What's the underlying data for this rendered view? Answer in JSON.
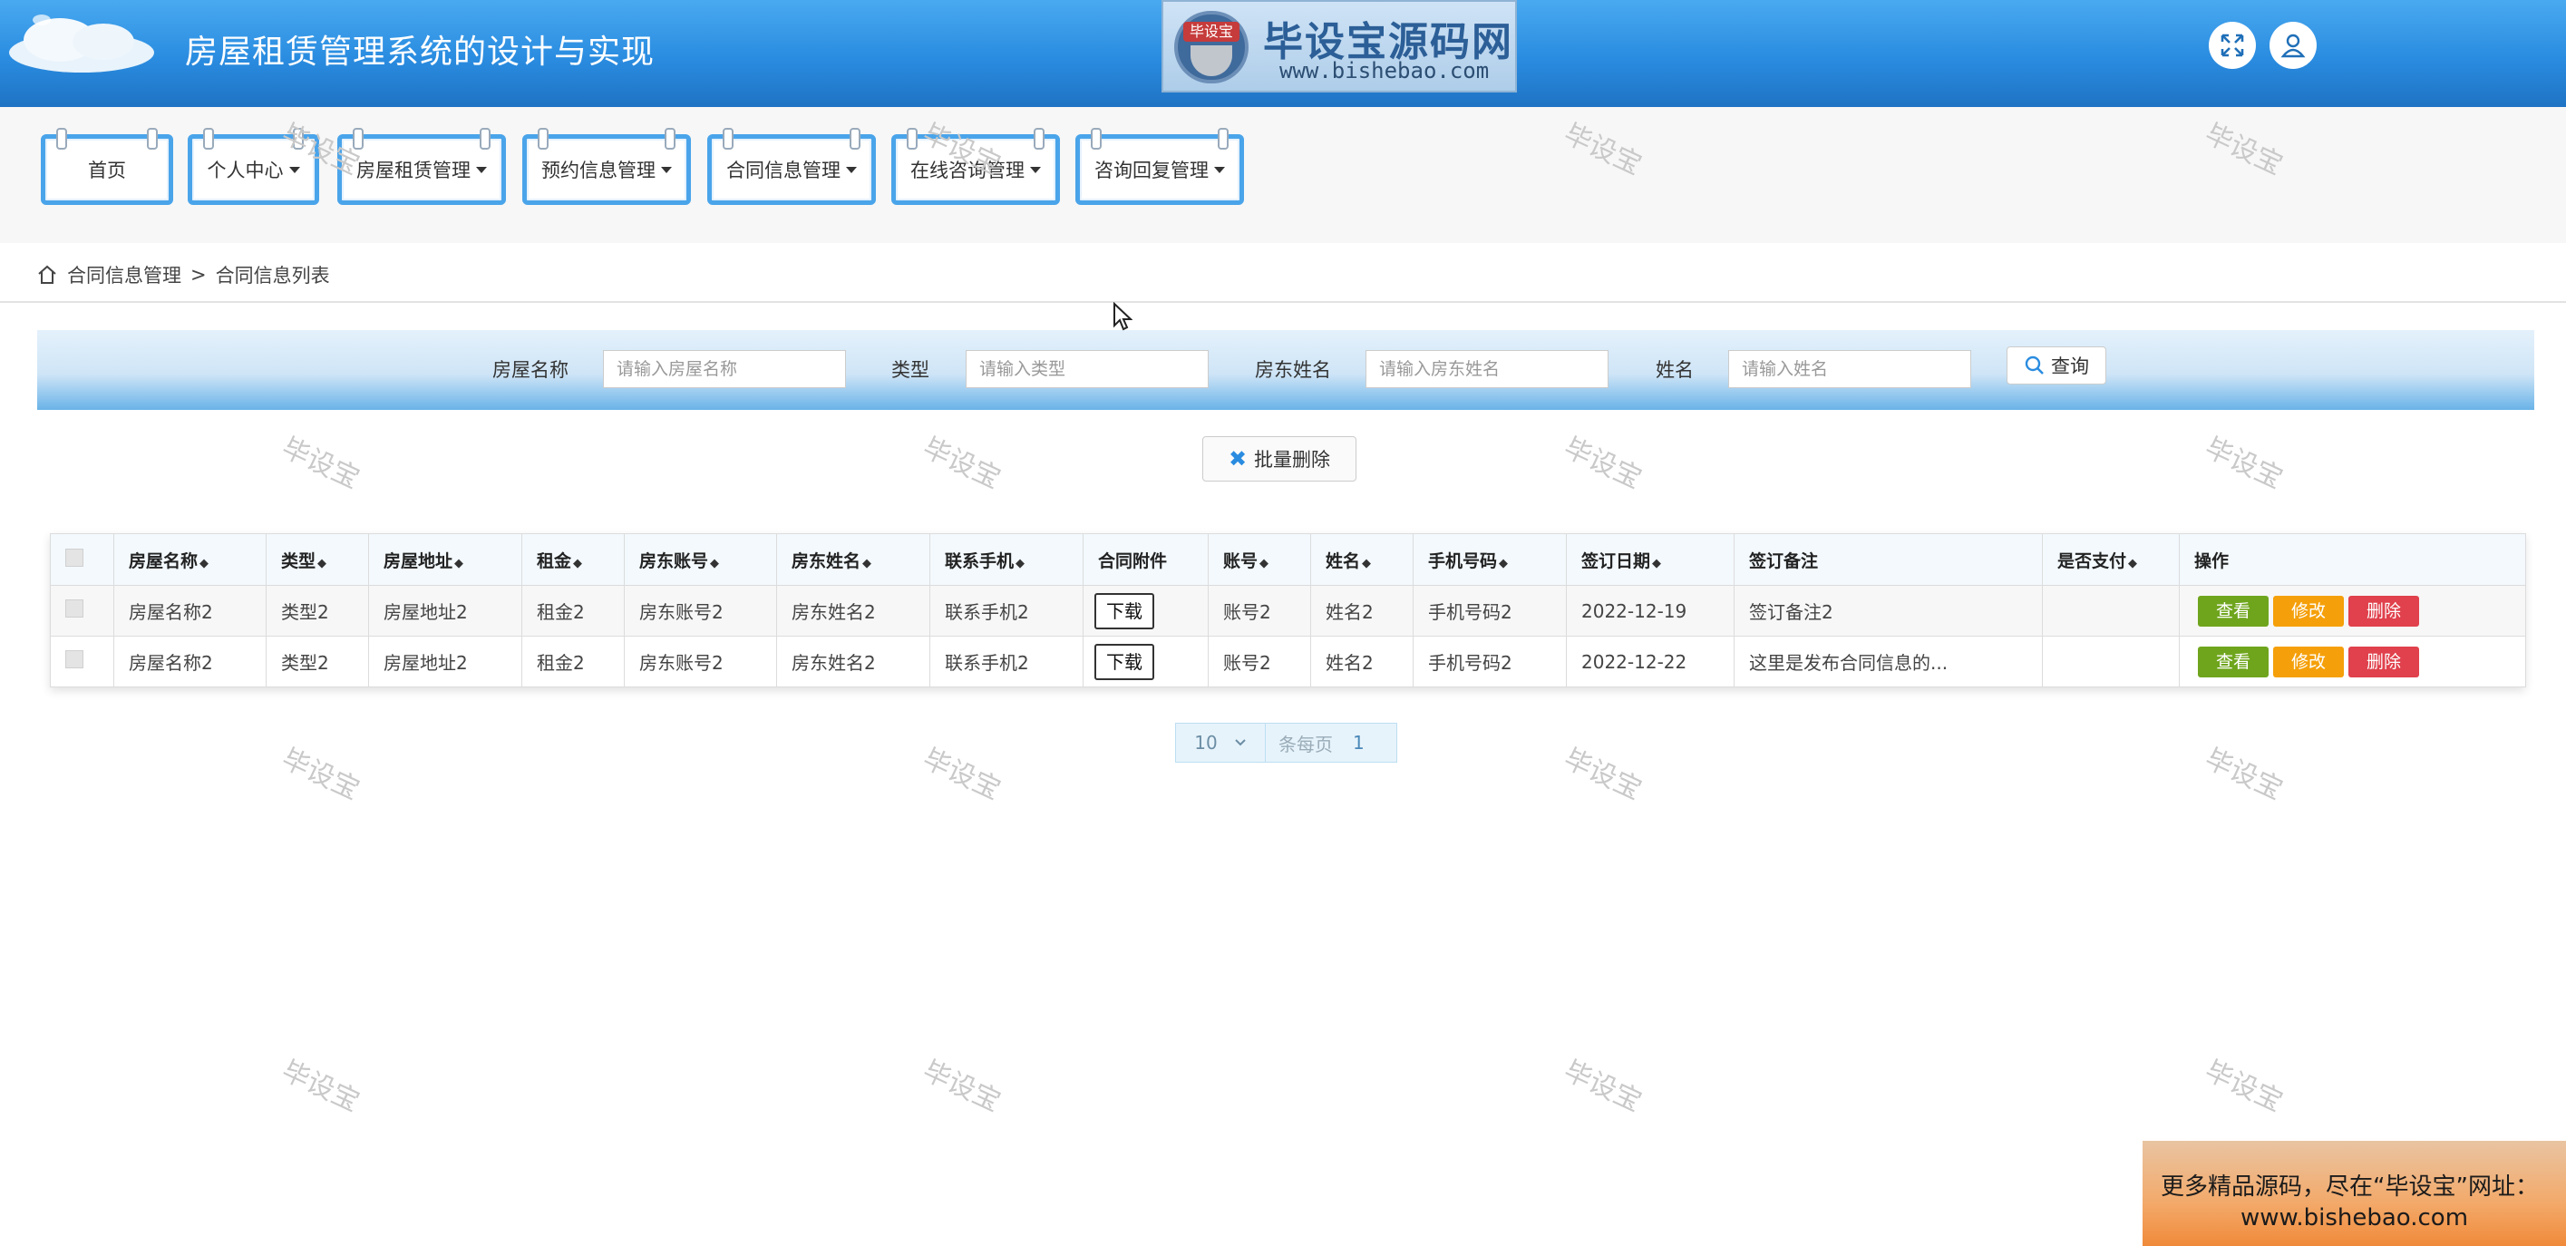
{
  "header": {
    "title": "房屋租赁管理系统的设计与实现",
    "logo_cn": "毕设宝源码网",
    "logo_url": "www.bishebao.com",
    "logo_badge": "毕设宝",
    "icons": [
      "fullscreen-icon",
      "user-icon"
    ]
  },
  "nav": {
    "items": [
      {
        "label": "首页",
        "dropdown": false
      },
      {
        "label": "个人中心",
        "dropdown": true
      },
      {
        "label": "房屋租赁管理",
        "dropdown": true
      },
      {
        "label": "预约信息管理",
        "dropdown": true
      },
      {
        "label": "合同信息管理",
        "dropdown": true
      },
      {
        "label": "在线咨询管理",
        "dropdown": true
      },
      {
        "label": "咨询回复管理",
        "dropdown": true
      }
    ]
  },
  "breadcrumb": {
    "section": "合同信息管理",
    "separator": ">",
    "page": "合同信息列表"
  },
  "search": {
    "fields": [
      {
        "label": "房屋名称",
        "placeholder": "请输入房屋名称"
      },
      {
        "label": "类型",
        "placeholder": "请输入类型"
      },
      {
        "label": "房东姓名",
        "placeholder": "请输入房东姓名"
      },
      {
        "label": "姓名",
        "placeholder": "请输入姓名"
      }
    ],
    "query_label": "查询"
  },
  "batch_delete_label": "批量删除",
  "table": {
    "columns": [
      "房屋名称",
      "类型",
      "房屋地址",
      "租金",
      "房东账号",
      "房东姓名",
      "联系手机",
      "合同附件",
      "账号",
      "姓名",
      "手机号码",
      "签订日期",
      "签订备注",
      "是否支付",
      "操作"
    ],
    "rows": [
      [
        "房屋名称2",
        "类型2",
        "房屋地址2",
        "租金2",
        "房东账号2",
        "房东姓名2",
        "联系手机2",
        "下载",
        "账号2",
        "姓名2",
        "手机号码2",
        "2022-12-19",
        "签订备注2",
        ""
      ],
      [
        "房屋名称2",
        "类型2",
        "房屋地址2",
        "租金2",
        "房东账号2",
        "房东姓名2",
        "联系手机2",
        "下载",
        "账号2",
        "姓名2",
        "手机号码2",
        "2022-12-22",
        "这里是发布合同信息的...",
        ""
      ]
    ],
    "actions": {
      "view": "查看",
      "edit": "修改",
      "delete": "删除"
    }
  },
  "pager": {
    "page_size": "10",
    "per_page_text": "条每页",
    "current_page": "1"
  },
  "watermark_text": "毕设宝",
  "promo": {
    "line1": "更多精品源码，尽在“毕设宝”网址：",
    "line2": "www.bishebao.com"
  },
  "colors": {
    "header_blue": "#2a8ce0",
    "nav_border": "#4aa4ea",
    "view_btn": "#6fa51d",
    "edit_btn": "#f5a00a",
    "delete_btn": "#e0414c",
    "promo_orange": "#f08a3a"
  }
}
